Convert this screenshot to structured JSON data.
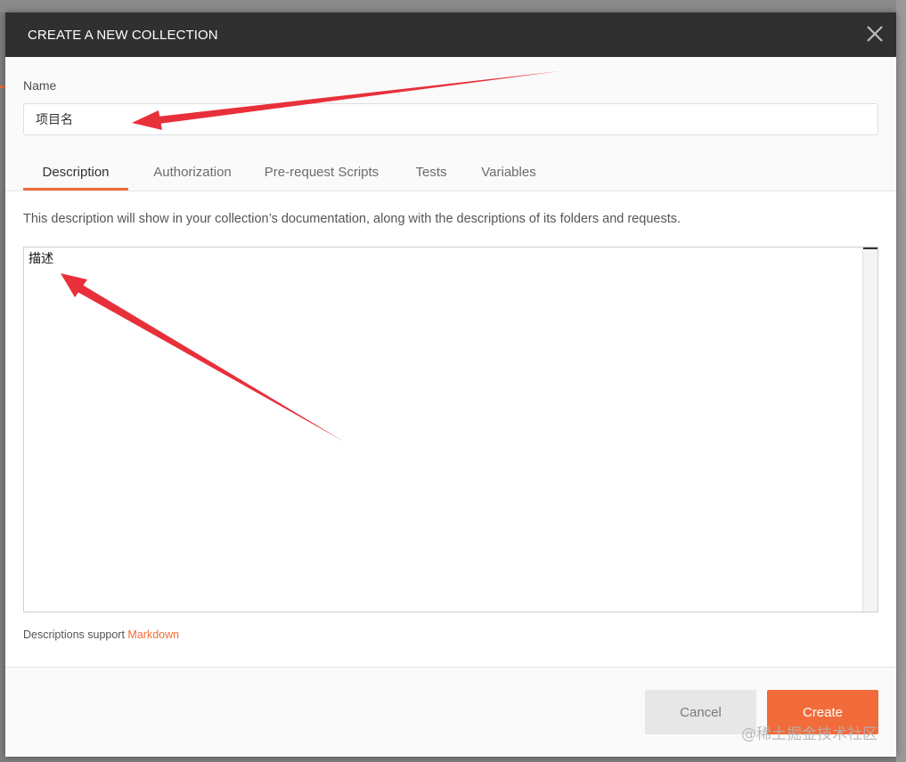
{
  "modal": {
    "title": "CREATE A NEW COLLECTION",
    "close_icon": "close-icon"
  },
  "name": {
    "label": "Name",
    "value": "项目名"
  },
  "tabs": [
    {
      "label": "Description",
      "active": true
    },
    {
      "label": "Authorization",
      "active": false
    },
    {
      "label": "Pre-request Scripts",
      "active": false
    },
    {
      "label": "Tests",
      "active": false
    },
    {
      "label": "Variables",
      "active": false
    }
  ],
  "description": {
    "help_text": "This description will show in your collection’s documentation, along with the descriptions of its folders and requests.",
    "value": "描述",
    "support_prefix": "Descriptions support ",
    "support_link": "Markdown"
  },
  "footer": {
    "cancel_label": "Cancel",
    "create_label": "Create"
  },
  "watermark": "@稀土掘金技术社区",
  "colors": {
    "accent": "#f26b3a",
    "header_bg": "#303030",
    "annotation_arrow": "#e8303a"
  }
}
